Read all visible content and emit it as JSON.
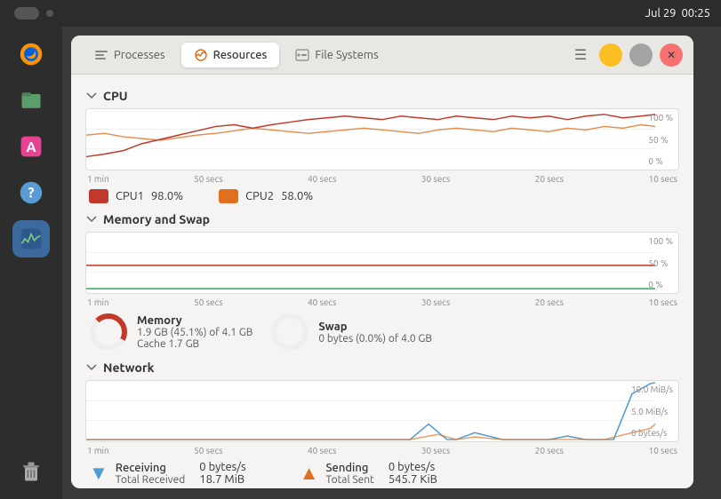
{
  "taskbar": {
    "date": "Jul 29",
    "time": "00:25"
  },
  "sidebar": {
    "icons": [
      {
        "name": "firefox-icon",
        "label": "Firefox"
      },
      {
        "name": "files-icon",
        "label": "Files"
      },
      {
        "name": "appstore-icon",
        "label": "App Store"
      },
      {
        "name": "help-icon",
        "label": "Help"
      },
      {
        "name": "sysmon-icon",
        "label": "System Monitor"
      },
      {
        "name": "trash-icon",
        "label": "Trash"
      }
    ]
  },
  "window": {
    "tabs": [
      {
        "id": "processes",
        "label": "Processes"
      },
      {
        "id": "resources",
        "label": "Resources",
        "active": true
      },
      {
        "id": "filesystems",
        "label": "File Systems"
      }
    ],
    "sections": {
      "cpu": {
        "title": "CPU",
        "time_labels": [
          "1 min",
          "50 secs",
          "40 secs",
          "30 secs",
          "20 secs",
          "10 secs"
        ],
        "right_labels": [
          "100 %",
          "50 %",
          "0 %"
        ],
        "indicators": [
          {
            "label": "CPU1",
            "value": "98.0%",
            "color": "#c0392b"
          },
          {
            "label": "CPU2",
            "value": "58.0%",
            "color": "#e67e22"
          }
        ]
      },
      "memory": {
        "title": "Memory and Swap",
        "time_labels": [
          "1 min",
          "50 secs",
          "40 secs",
          "30 secs",
          "20 secs",
          "10 secs"
        ],
        "right_labels": [
          "100 %",
          "50 %",
          "0 %"
        ],
        "memory": {
          "label": "Memory",
          "value": "1.9 GB (45.1%) of 4.1 GB",
          "cache": "Cache 1.7 GB",
          "percent": 45.1
        },
        "swap": {
          "label": "Swap",
          "value": "0 bytes (0.0%) of 4.0 GB",
          "percent": 0
        }
      },
      "network": {
        "title": "Network",
        "time_labels": [
          "1 min",
          "50 secs",
          "40 secs",
          "30 secs",
          "20 secs",
          "10 secs"
        ],
        "right_labels": [
          "10.0 MiB/s",
          "5.0 MiB/s",
          "0 bytes/s"
        ],
        "receiving": {
          "label": "Receiving",
          "sublabel": "Total Received",
          "rate": "0 bytes/s",
          "total": "18.7 MiB"
        },
        "sending": {
          "label": "Sending",
          "sublabel": "Total Sent",
          "rate": "0 bytes/s",
          "total": "545.7 KiB"
        }
      }
    }
  }
}
